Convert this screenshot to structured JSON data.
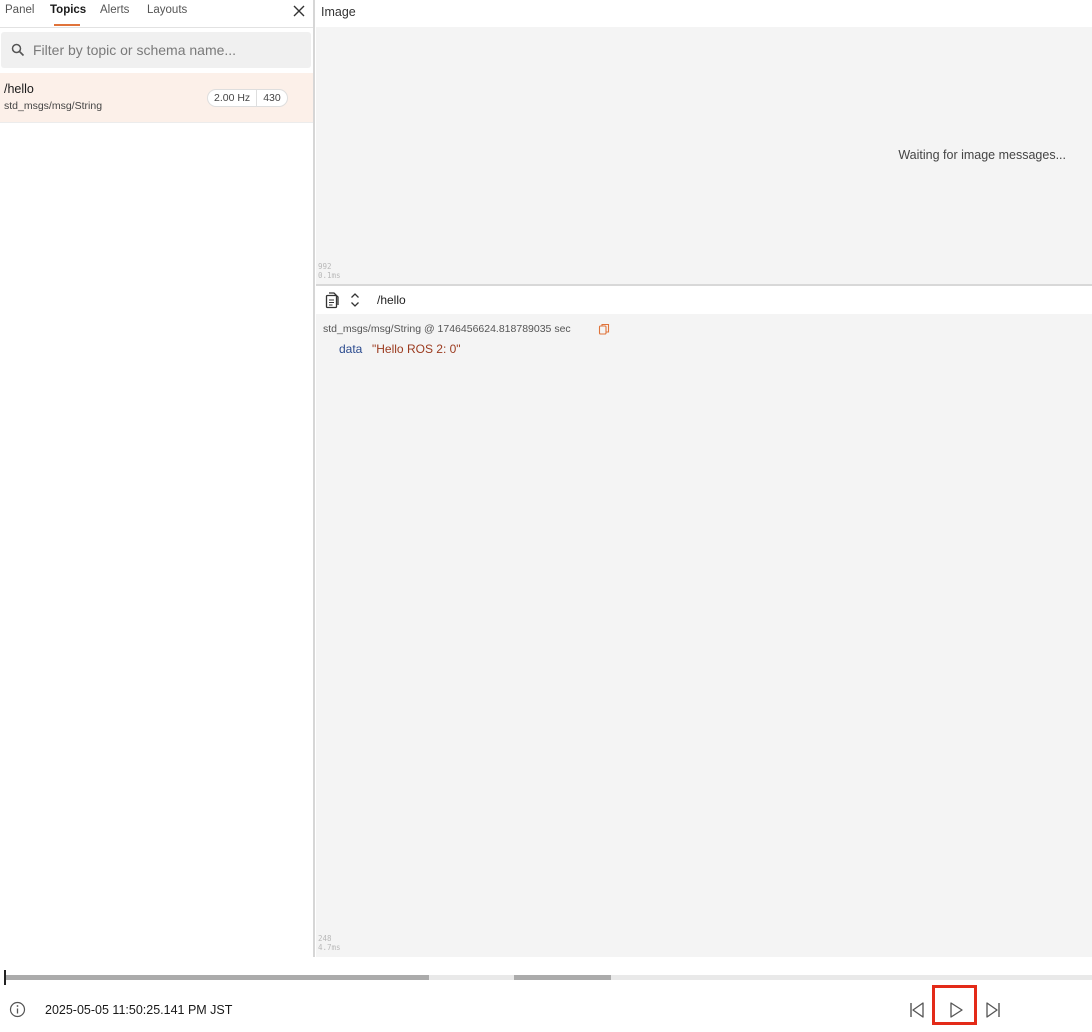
{
  "sidebar": {
    "tabs": [
      {
        "label": "Panel"
      },
      {
        "label": "Topics"
      },
      {
        "label": "Alerts"
      },
      {
        "label": "Layouts"
      }
    ],
    "active_tab": "Topics",
    "filter": {
      "placeholder": "Filter by topic or schema name...",
      "value": ""
    },
    "topics": [
      {
        "name": "/hello",
        "schema": "std_msgs/msg/String",
        "frequency": "2.00 Hz",
        "count": "430"
      }
    ]
  },
  "image_panel": {
    "title": "Image",
    "status": "Waiting for image messages...",
    "perf_a": "992",
    "perf_b": "0.1ms"
  },
  "raw_panel": {
    "topic_path": "/hello",
    "meta": "std_msgs/msg/String @ 1746456624.818789035 sec",
    "field_key": "data",
    "field_value": "\"Hello ROS 2: 0\"",
    "perf_a": "248",
    "perf_b": "4.7ms"
  },
  "playback": {
    "timestamp": "2025-05-05 11:50:25.141 PM JST",
    "accent_color": "#e0733a",
    "highlight_color": "#e32a18"
  }
}
